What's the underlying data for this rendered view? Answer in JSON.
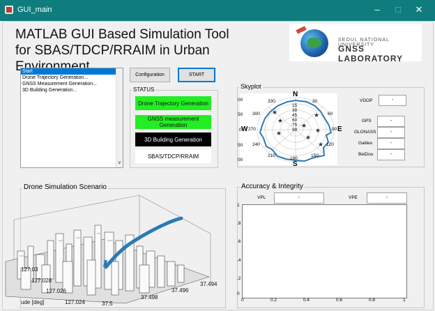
{
  "window": {
    "title": "GUI_main"
  },
  "header": {
    "title_line1": "MATLAB GUI Based Simulation Tool",
    "title_line2": "for SBAS/TDCP/RRAIM in Urban Environment"
  },
  "logo": {
    "line1": "SEOUL NATIONAL UNIVERSITY",
    "line2": "GNSS LABORATORY"
  },
  "menu_list": {
    "items": [
      "Start",
      "Drone Trajectory Generation...",
      "GNSS Measurement Generation...",
      "3D Building Generation..."
    ],
    "selected_index": 0
  },
  "buttons": {
    "configuration": "Configuration",
    "start": "START"
  },
  "status": {
    "title": "STATUS",
    "items": [
      {
        "label": "Drone Trajectory Generation",
        "color": "#22ee22",
        "text_color": "#111111"
      },
      {
        "label": "GNSS measurement Generation",
        "color": "#22ee22",
        "text_color": "#111111"
      },
      {
        "label": "3D Building Generation",
        "color": "#000000",
        "text_color": "#ffffff"
      },
      {
        "label": "SBAS/TDCP/RRAIM",
        "color": "#ffffff",
        "text_color": "#000000"
      }
    ]
  },
  "skyplot": {
    "title": "Skyplot",
    "cardinals": {
      "n": "N",
      "e": "E",
      "s": "S",
      "w": "W"
    },
    "azimuth_labels": [
      "330",
      "30",
      "60",
      "90",
      "120",
      "150",
      "180",
      "210",
      "240",
      "270",
      "300"
    ],
    "elevation_labels": [
      "15",
      "30",
      "45",
      "60",
      "75",
      "90"
    ],
    "left_axis_labels": [
      "00",
      "50",
      "0",
      "50",
      "00"
    ],
    "dop_label": "VDOP",
    "dop_value": "-",
    "constellations": [
      {
        "label": "GPS",
        "value": "-"
      },
      {
        "label": "GLONASS",
        "value": "-"
      },
      {
        "label": "Galileo",
        "value": "-"
      },
      {
        "label": "BeiDou",
        "value": "-"
      }
    ],
    "mask_color": "#2a7ab8"
  },
  "scenario": {
    "title": "Drone Simulation Scenario",
    "axis_ticks_left": [
      "127.03",
      "127.028",
      "127.026",
      "127.024"
    ],
    "axis_ticks_right": [
      "37.5",
      "37.498",
      "37.496",
      "37.494"
    ],
    "axis_label": "ude [deg]",
    "trajectory_color": "#2a7ab8"
  },
  "accuracy": {
    "title": "Accuracy & Integrity",
    "vpl_label": "VPL",
    "vpl_value": "-",
    "vpe_label": "VPE",
    "vpe_value": "-",
    "yticks": [
      "1",
      ".8",
      ".6",
      ".4",
      ".2",
      "0"
    ],
    "xticks": [
      "0",
      "0.2",
      "0.4",
      "0.6",
      "0.8",
      "1"
    ]
  }
}
